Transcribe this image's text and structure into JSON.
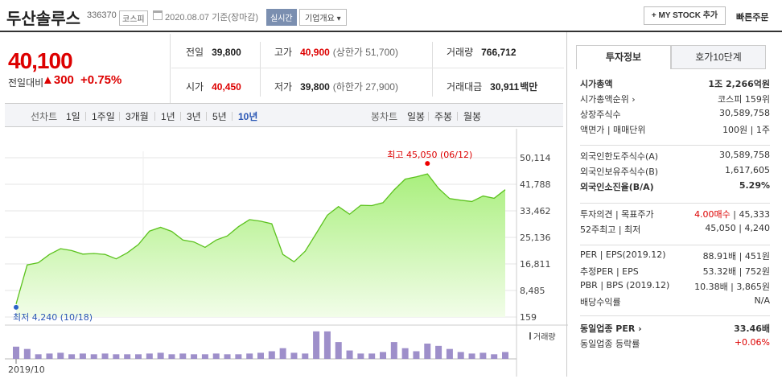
{
  "header": {
    "stock_name": "두산솔루스",
    "code": "336370",
    "market": "코스피",
    "date_text": "2020.08.07  기준(장마감)",
    "realtime_label": "실시간",
    "corp_summary_label": "기업개요 ▾",
    "mystock_label": "+ MY STOCK 추가",
    "quick_order_label": "빠른주문"
  },
  "price": {
    "current": "40,100",
    "change_label": "전일대비",
    "change": "▲300",
    "change_pct": "+0.75%"
  },
  "stats": {
    "prev_close_label": "전일",
    "prev_close": "39,800",
    "high_label": "고가",
    "high": "40,900",
    "high_sub": "(상한가 51,700)",
    "volume_label": "거래량",
    "volume": "766,712",
    "open_label": "시가",
    "open": "40,450",
    "low_label": "저가",
    "low": "39,800",
    "low_sub": "(하한가 27,900)",
    "amount_label": "거래대금",
    "amount": "30,911",
    "amount_unit": "백만"
  },
  "period_tabs": {
    "line_label": "선차트",
    "items": [
      "1일",
      "1주일",
      "3개월",
      "1년",
      "3년",
      "5년",
      "10년"
    ],
    "active": "10년",
    "candle_label": "봉차트",
    "candle_items": [
      "일봉",
      "주봉",
      "월봉"
    ]
  },
  "chart_data": {
    "type": "area",
    "x": [
      "2019/10",
      "",
      "",
      "",
      "",
      "",
      "",
      "",
      "",
      "",
      "",
      "",
      "",
      "",
      "",
      "",
      "",
      "",
      "",
      "",
      "",
      "",
      "",
      "",
      "",
      "",
      "",
      "",
      "",
      "",
      "",
      "",
      "",
      "",
      "",
      "",
      "",
      "",
      "",
      "",
      "",
      "",
      "",
      ""
    ],
    "values": [
      4240,
      16500,
      17200,
      19800,
      21600,
      21000,
      19900,
      20100,
      19800,
      18400,
      20300,
      22900,
      27100,
      28300,
      27000,
      24300,
      23700,
      22000,
      24300,
      25600,
      28500,
      30700,
      30200,
      29400,
      19800,
      17500,
      20800,
      26400,
      32100,
      34800,
      32400,
      35200,
      35100,
      36000,
      40000,
      43400,
      44100,
      45050,
      40500,
      37300,
      36800,
      36400,
      38100,
      37400,
      40100
    ],
    "volumes": [
      1.6,
      1.3,
      0.6,
      0.7,
      0.8,
      0.6,
      0.7,
      0.6,
      0.7,
      0.6,
      0.6,
      0.6,
      0.7,
      0.8,
      0.6,
      0.7,
      0.6,
      0.6,
      0.7,
      0.6,
      0.6,
      0.7,
      0.8,
      1.0,
      1.4,
      0.8,
      0.7,
      3.6,
      3.6,
      2.2,
      1.1,
      0.7,
      0.7,
      0.9,
      2.2,
      1.4,
      1.0,
      2.0,
      1.7,
      1.3,
      0.9,
      0.7,
      0.8,
      0.6,
      0.9
    ],
    "ylim": [
      159,
      50114
    ],
    "ytick_labels": [
      "50,114",
      "41,788",
      "33,462",
      "25,136",
      "16,811",
      "8,485",
      "159"
    ],
    "high_annotation": "최고 45,050 (06/12)",
    "low_annotation": "최저 4,240 (10/18)",
    "volume_label": "거래량",
    "x_tick": "2019/10",
    "grid": true
  },
  "right": {
    "tabs": [
      "투자정보",
      "호가10단계"
    ],
    "active_tab": "투자정보",
    "group1": [
      {
        "label": "시가총액",
        "value": "1조 2,266억원",
        "bold": true
      },
      {
        "label": "시가총액순위 ›",
        "value": "코스피 159위"
      },
      {
        "label": "상장주식수",
        "value": "30,589,758"
      },
      {
        "label": "액면가 | 매매단위",
        "value": "100원 | 1주"
      }
    ],
    "group2": [
      {
        "label": "외국인한도주식수(A)",
        "value": "30,589,758"
      },
      {
        "label": "외국인보유주식수(B)",
        "value": "1,617,605"
      },
      {
        "label": "외국인소진율(B/A)",
        "value": "5.29%",
        "bold": true
      }
    ],
    "group3": [
      {
        "label": "투자의견 | 목표주가",
        "value": "4.00매수 | 45,333"
      },
      {
        "label": "52주최고 | 최저",
        "value": "45,050 | 4,240"
      }
    ],
    "group4": [
      {
        "label": "PER | EPS(2019.12)",
        "value": "88.91배 | 451원"
      },
      {
        "label": "추정PER | EPS",
        "value": "53.32배 | 752원"
      },
      {
        "label": "PBR | BPS (2019.12)",
        "value": "10.38배 | 3,865원"
      },
      {
        "label": "배당수익률",
        "value": "N/A"
      }
    ],
    "group5": [
      {
        "label": "동일업종 PER ›",
        "value": "33.46배",
        "bold": true
      },
      {
        "label": "동일업종 등락률",
        "value": "+0.06%"
      }
    ],
    "opinion_value": "4.00매수"
  }
}
